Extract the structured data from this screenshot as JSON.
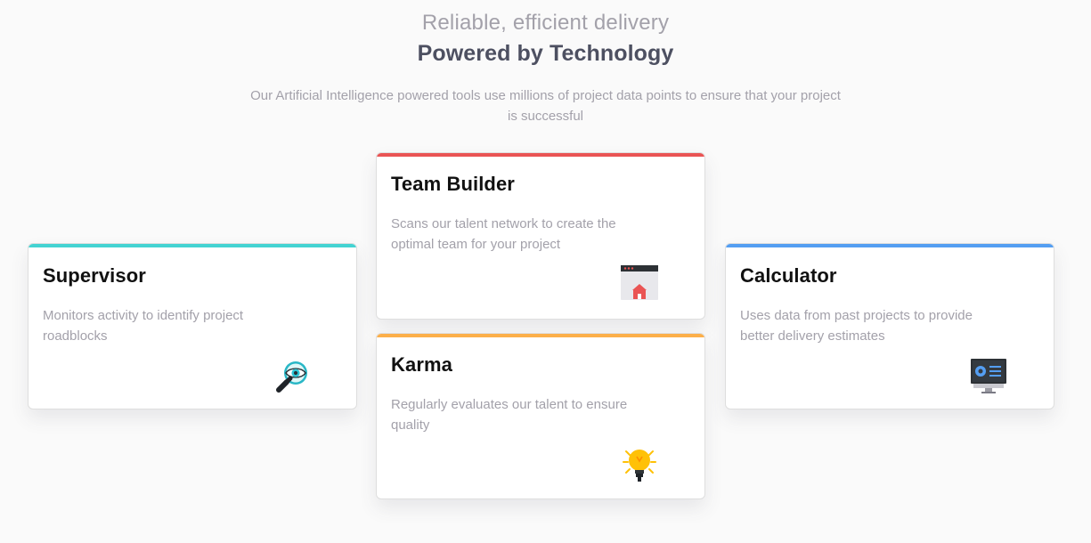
{
  "header": {
    "subtitle": "Reliable, efficient delivery",
    "title": "Powered by Technology",
    "intro": "Our Artificial Intelligence powered tools use millions of project data points to ensure that your project is successful"
  },
  "cards": [
    {
      "title": "Supervisor",
      "description": "Monitors activity to identify project roadblocks",
      "icon": "magnifier-eye-icon",
      "accent": "#44d3d2"
    },
    {
      "title": "Team Builder",
      "description": "Scans our talent network to create the optimal team for your project",
      "icon": "team-builder-icon",
      "accent": "#ea5454"
    },
    {
      "title": "Karma",
      "description": "Regularly evaluates our talent to ensure quality",
      "icon": "lightbulb-icon",
      "accent": "#fcaf4a"
    },
    {
      "title": "Calculator",
      "description": "Uses data from past projects to provide better delivery estimates",
      "icon": "monitor-chart-icon",
      "accent": "#549ef2"
    }
  ]
}
